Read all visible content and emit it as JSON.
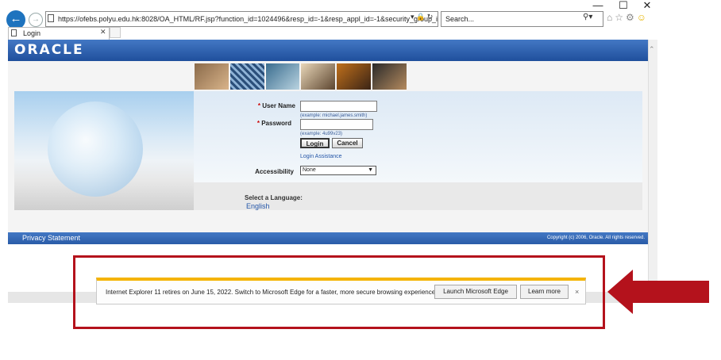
{
  "browser": {
    "url": "https://ofebs.polyu.edu.hk:8028/OA_HTML/RF.jsp?function_id=1024496&resp_id=-1&resp_appl_id=-1&security_group_id=0&lang",
    "search_placeholder": "Search...",
    "tab_title": "Login",
    "window_controls": [
      "—",
      "☐",
      "✕"
    ]
  },
  "oracle": {
    "logo": "ORACLE",
    "form": {
      "username_label": "User Name",
      "username_hint": "(example: michael.james.smith)",
      "password_label": "Password",
      "password_hint": "(example: 4u99v23)",
      "login_button": "Login",
      "cancel_button": "Cancel",
      "login_assistance": "Login Assistance",
      "accessibility_label": "Accessibility",
      "accessibility_value": "None",
      "language_label": "Select a Language:",
      "language_value": "English"
    },
    "footer": {
      "privacy": "Privacy Statement",
      "copyright": "Copyright (c) 2006, Oracle. All rights reserved."
    }
  },
  "notification": {
    "message": "Internet Explorer 11 retires on June 15, 2022. Switch to Microsoft Edge for a faster, more secure browsing experience.",
    "launch_button": "Launch Microsoft Edge",
    "learn_button": "Learn more",
    "close": "×"
  },
  "colors": {
    "oracle_blue": "#1f4f9c",
    "notification_stripe": "#f5b300",
    "annotation_red": "#b4121c"
  },
  "icons": [
    "back-arrow-icon",
    "forward-arrow-icon",
    "page-icon",
    "lock-icon",
    "refresh-icon",
    "search-icon",
    "home-icon",
    "star-icon",
    "gear-icon",
    "smiley-icon",
    "close-icon",
    "chevron-down-icon",
    "red-arrow-icon"
  ]
}
